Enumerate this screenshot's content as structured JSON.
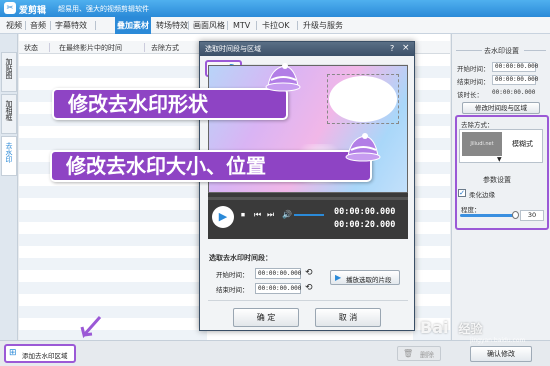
{
  "app": {
    "name": "爱剪辑",
    "slogan": "超易用、强大的视频剪辑软件"
  },
  "menu": {
    "items": [
      "视频",
      "音频",
      "字幕特效",
      "叠加素材",
      "转场特效",
      "画面风格",
      "MTV",
      "卡拉OK",
      "升级与服务"
    ],
    "active_index": 3
  },
  "left_tabs": [
    "加贴图",
    "加相框",
    "去水印"
  ],
  "columns": [
    "状态",
    "在最终影片中的时间",
    "去除方式"
  ],
  "right_panel": {
    "section1_title": "去水印设置",
    "start_label": "开始时间：",
    "start_value": "00:00:00.000",
    "end_label": "结束时间：",
    "end_value": "00:00:00.000",
    "duration_label": "该时长：",
    "duration_value": "00:00:00.000",
    "modify_button": "修改时间段与区域",
    "method_label": "去除方式：",
    "method_value": "模糊式",
    "method_preview_text": "Jiliudi.net",
    "section2_title": "参数设置",
    "soft_edge_label": "柔化边缘",
    "level_label": "程度：",
    "level_value": "30"
  },
  "bottom": {
    "add_button": "添加去水印区域",
    "delete_button": "删除",
    "confirm_button": "确认修改"
  },
  "dialog": {
    "title": "选取时间段与区域",
    "time_main": "00:00:00.000",
    "time_total": "00:00:20.000",
    "section_title": "选取去水印时间段：",
    "start_label": "开始时间：",
    "start_value": "00:00:00.000",
    "end_label": "结束时间：",
    "end_value": "00:00:00.000",
    "play_button": "播放选取的片段",
    "ok_button": "确 定",
    "cancel_button": "取 消"
  },
  "overlay": {
    "banner1": "修改去水印形状",
    "banner2": "修改去水印大小、位置"
  },
  "watermark": "Bai",
  "watermark2": "经验",
  "watermark_url": "jingyan.baidu.com",
  "colors": {
    "accent": "#2b8ad8",
    "highlight": "#9b59d6",
    "banner": "#8e44c4"
  }
}
